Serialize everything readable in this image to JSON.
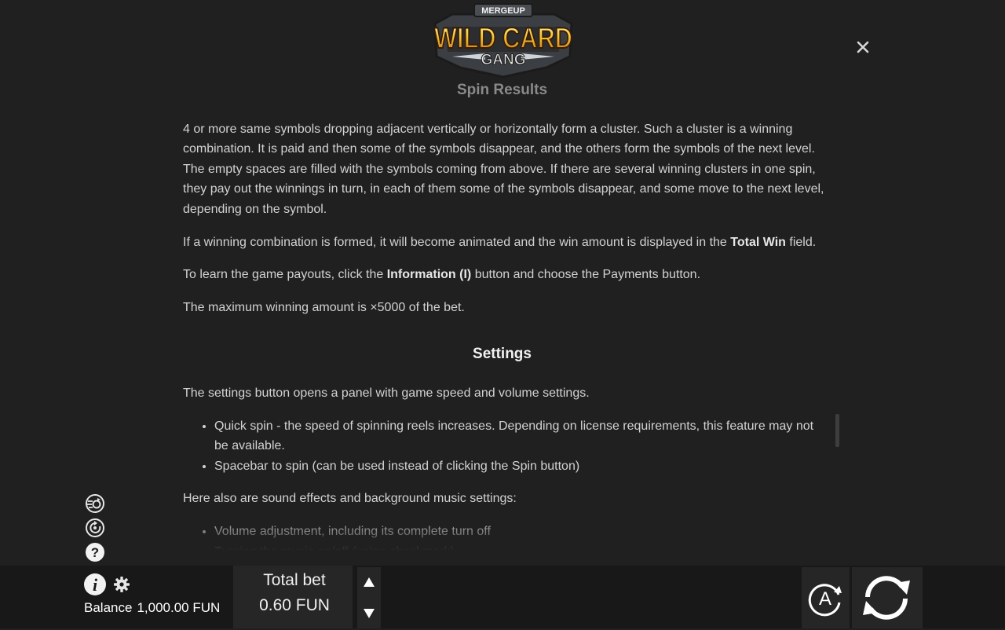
{
  "logo": {
    "brand": "MERGEUP",
    "title_line1": "WILD CARD",
    "title_line2": "GANG"
  },
  "help": {
    "spin_results": {
      "title": "Spin Results",
      "p1": "4 or more same symbols dropping adjacent vertically or horizontally form a cluster. Such a cluster is a winning combination. It is paid and then some of the symbols disappear, and the others form the symbols of the next level. The empty spaces are filled with the symbols coming from above. If there are several winning clusters in one spin, they pay out the winnings in turn, in each of them some of the symbols disappear, and some move to the next level, depending on the symbol.",
      "p2_before": "If a winning combination is formed, it will become animated and the win amount is displayed in the ",
      "p2_bold": "Total Win",
      "p2_after": " field.",
      "p3_before": "To learn the game payouts, click the ",
      "p3_bold": "Information (I)",
      "p3_after": " button and choose the Payments button.",
      "p4": "The maximum winning amount is ×5000 of the bet."
    },
    "settings": {
      "title": "Settings",
      "intro": "The settings button opens a panel with game speed and volume settings.",
      "list1": [
        "Quick spin - the speed of spinning reels increases. Depending on license requirements, this feature may not be available.",
        "Spacebar to spin (can be used instead of clicking the Spin button)"
      ],
      "sound_intro": "Here also are sound effects and background music settings:",
      "list2": [
        "Volume adjustment, including its complete turn off",
        "Turning the music on/off (using checkmark)"
      ]
    }
  },
  "bottom_bar": {
    "balance_label": "Balance",
    "balance_value": "1,000.00 FUN",
    "total_bet_label": "Total bet",
    "total_bet_value": "0.60 FUN",
    "autoplay_label": "A"
  },
  "colors": {
    "background": "#202020",
    "bottom_bar": "#181818",
    "panel": "#262626",
    "logo_gold": "#f3b62a",
    "text": "#d2d2d2"
  },
  "icons": {
    "close": "close-icon",
    "quick_spin": "quick-spin-icon",
    "history": "history-icon",
    "help": "help-icon",
    "info": "info-icon",
    "settings": "gear-icon",
    "bet_up": "arrow-up-icon",
    "bet_down": "arrow-down-icon",
    "autoplay": "autoplay-icon",
    "spin": "spin-icon"
  }
}
